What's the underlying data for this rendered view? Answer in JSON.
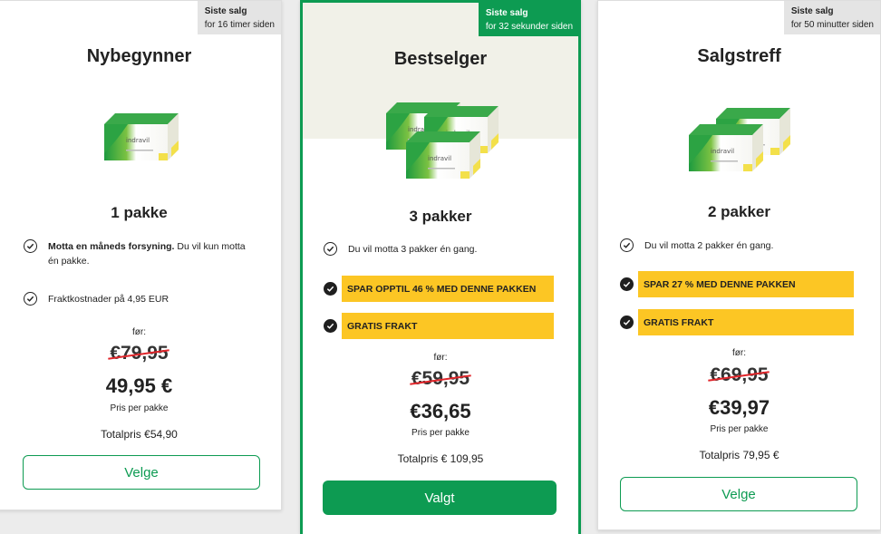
{
  "colors": {
    "accent": "#0d9b52",
    "highlight": "#fcc624",
    "strike": "#e1262b"
  },
  "cards": [
    {
      "badge_title": "Siste salg",
      "badge_time": "for 16 timer siden",
      "title": "Nybegynner",
      "packs": "1 pakke",
      "feature1_bold": "Motta en måneds forsyning.",
      "feature1_rest": " Du vil kun motta én pakke.",
      "feature2": "Fraktkostnader på 4,95 EUR",
      "before_label": "før:",
      "old_price": "€79,95",
      "price": "49,95 €",
      "per_pack": "Pris per pakke",
      "total": "Totalpris €54,90",
      "button": "Velge"
    },
    {
      "badge_title": "Siste salg",
      "badge_time": "for 32 sekunder siden",
      "title": "Bestselger",
      "packs": "3 pakker",
      "feature1": "Du vil motta 3 pakker én gang.",
      "highlight1": "SPAR OPPTIL 46 % MED DENNE PAKKEN",
      "highlight2": "GRATIS FRAKT",
      "before_label": "før:",
      "old_price": "€59,95",
      "price": "€36,65",
      "per_pack": "Pris per pakke",
      "total": "Totalpris € 109,95",
      "button": "Valgt"
    },
    {
      "badge_title": "Siste salg",
      "badge_time": "for 50 minutter siden",
      "title": "Salgstreff",
      "packs": "2 pakker",
      "feature1": "Du vil motta 2 pakker én gang.",
      "highlight1": "SPAR 27 % MED DENNE PAKKEN",
      "highlight2": "GRATIS FRAKT",
      "before_label": "før:",
      "old_price": "€69,95",
      "price": "€39,97",
      "per_pack": "Pris per pakke",
      "total": "Totalpris 79,95 €",
      "button": "Velge"
    }
  ],
  "icons": [
    "check-circle-icon",
    "product-box-image"
  ],
  "product_brand": "indravil"
}
